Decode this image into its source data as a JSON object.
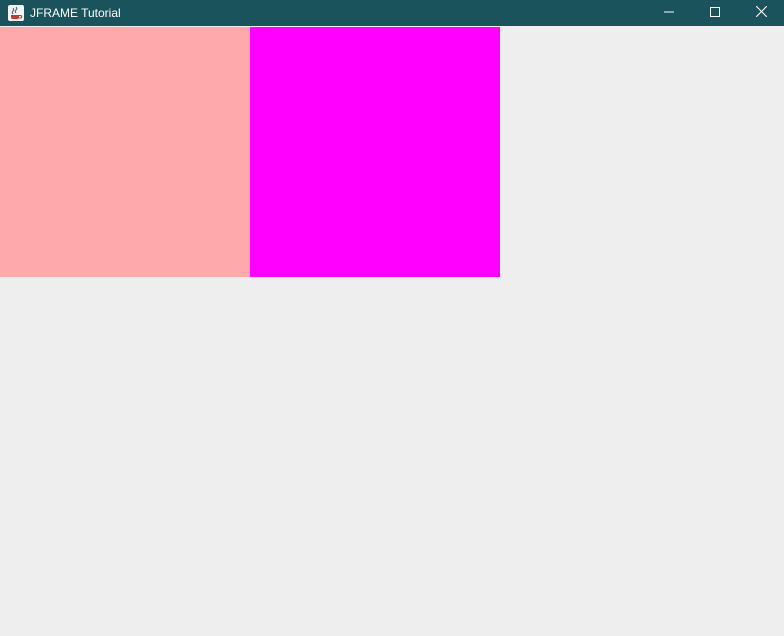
{
  "window": {
    "title": "JFRAME Tutorial",
    "app_icon": "java-coffee-cup-icon",
    "controls": {
      "minimize_icon": "minimize-icon",
      "maximize_icon": "maximize-icon",
      "close_icon": "close-icon"
    },
    "titlebar_color": "#1a535c"
  },
  "panels": [
    {
      "color": "#ffaaaa"
    },
    {
      "color": "#ff00ff"
    }
  ],
  "background_color": "#eeeeee"
}
